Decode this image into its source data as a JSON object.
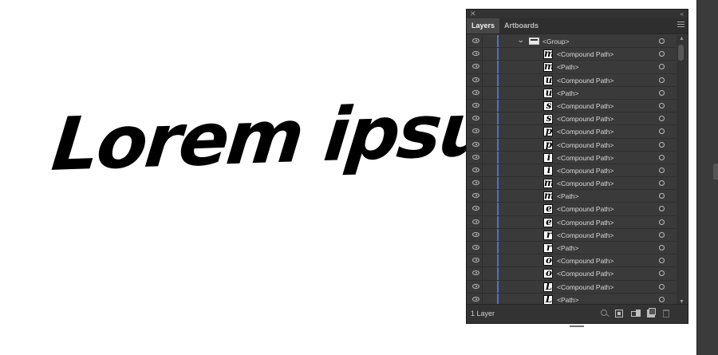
{
  "artwork": {
    "text": "Lorem ipsum"
  },
  "panel": {
    "tabs": [
      {
        "label": "Layers",
        "active": true
      },
      {
        "label": "Artboards",
        "active": false
      }
    ],
    "layer_colour": "#4f6fd1",
    "rows": [
      {
        "label": "<Group>",
        "kind": "group",
        "glyph": ""
      },
      {
        "label": "<Compound Path>",
        "kind": "item",
        "glyph": "m"
      },
      {
        "label": "<Path>",
        "kind": "item",
        "glyph": "m"
      },
      {
        "label": "<Compound Path>",
        "kind": "item",
        "glyph": "u"
      },
      {
        "label": "<Path>",
        "kind": "item",
        "glyph": "u"
      },
      {
        "label": "<Compound Path>",
        "kind": "item",
        "glyph": "s"
      },
      {
        "label": "<Compound Path>",
        "kind": "item",
        "glyph": "s"
      },
      {
        "label": "<Compound Path>",
        "kind": "item",
        "glyph": "p"
      },
      {
        "label": "<Compound Path>",
        "kind": "item",
        "glyph": "p"
      },
      {
        "label": "<Compound Path>",
        "kind": "item",
        "glyph": "i"
      },
      {
        "label": "<Compound Path>",
        "kind": "item",
        "glyph": "i"
      },
      {
        "label": "<Compound Path>",
        "kind": "item",
        "glyph": "m"
      },
      {
        "label": "<Path>",
        "kind": "item",
        "glyph": "m"
      },
      {
        "label": "<Compound Path>",
        "kind": "item",
        "glyph": "e"
      },
      {
        "label": "<Compound Path>",
        "kind": "item",
        "glyph": "e"
      },
      {
        "label": "<Compound Path>",
        "kind": "item",
        "glyph": "r"
      },
      {
        "label": "<Path>",
        "kind": "item",
        "glyph": "r"
      },
      {
        "label": "<Compound Path>",
        "kind": "item",
        "glyph": "o"
      },
      {
        "label": "<Compound Path>",
        "kind": "item",
        "glyph": "o"
      },
      {
        "label": "<Compound Path>",
        "kind": "item",
        "glyph": "L"
      },
      {
        "label": "<Path>",
        "kind": "item",
        "glyph": "L"
      }
    ],
    "footer": {
      "layer_count": "1 Layer"
    },
    "icons": {
      "close": "close-icon",
      "collapse": "collapse-icon",
      "menu": "panel-menu-icon",
      "visibility": "eye-icon",
      "target": "target-circle-icon",
      "footer": [
        "search-icon",
        "clipping-mask-icon",
        "new-sublayer-icon",
        "new-layer-icon",
        "trash-icon"
      ]
    }
  }
}
